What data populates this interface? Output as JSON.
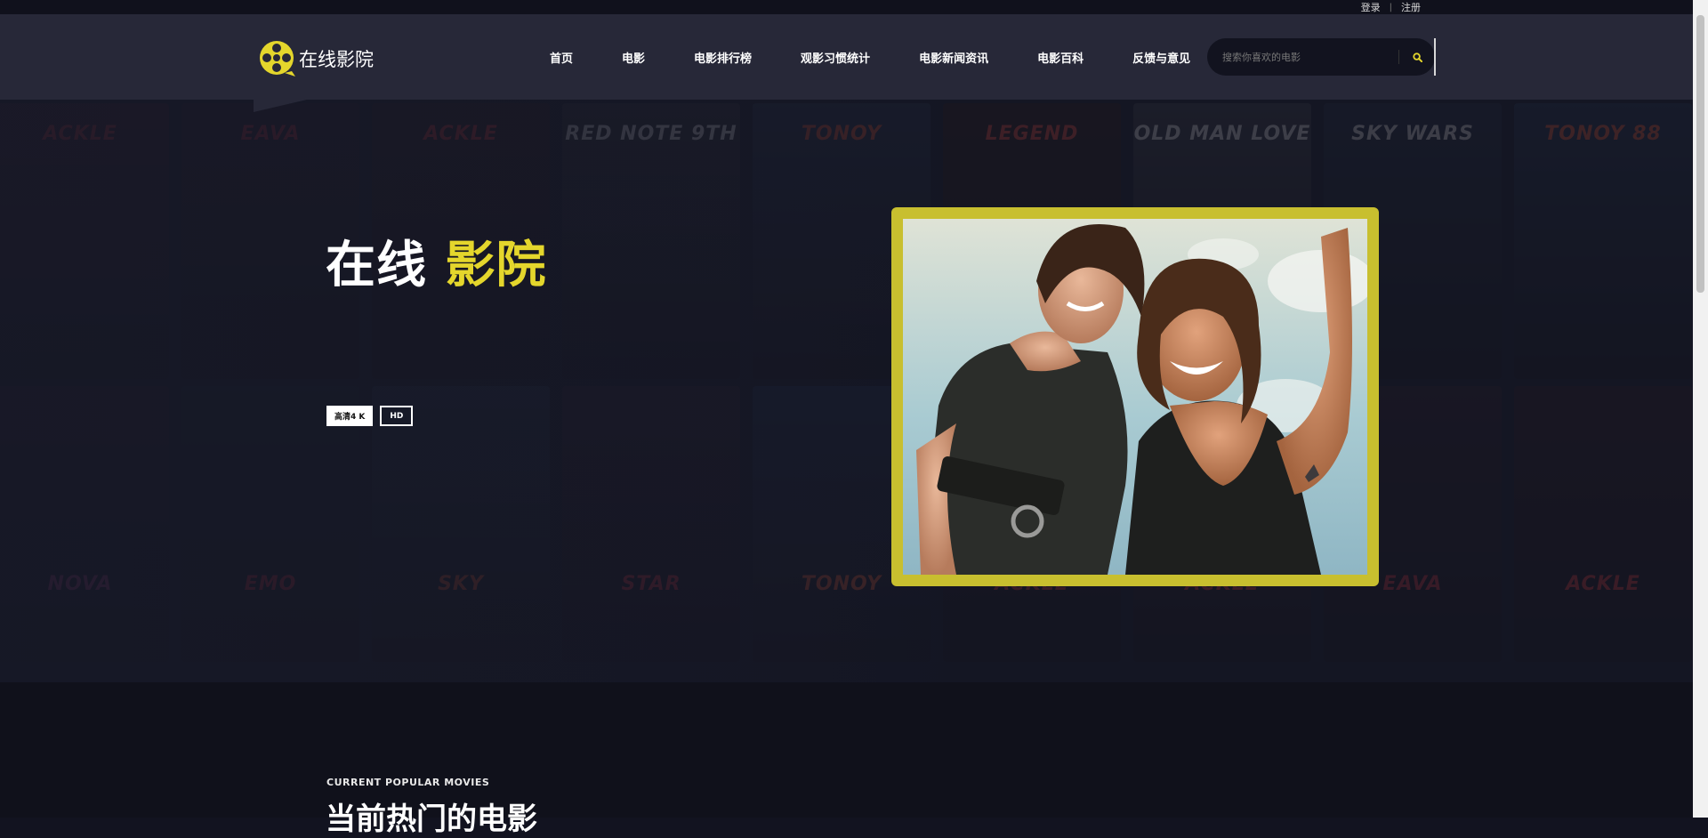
{
  "topbar": {
    "login": "登录",
    "separator": "|",
    "register": "注册"
  },
  "header": {
    "logo_text": "在线影院",
    "nav": [
      {
        "label": "首页"
      },
      {
        "label": "电影"
      },
      {
        "label": "电影排行榜"
      },
      {
        "label": "观影习惯统计"
      },
      {
        "label": "电影新闻资讯"
      },
      {
        "label": "电影百科"
      },
      {
        "label": "反馈与意见"
      }
    ],
    "search_placeholder": "搜索你喜欢的电影"
  },
  "hero": {
    "title_part1": "在线",
    "title_part2": "影院",
    "badges": [
      "高清4 K",
      "HD"
    ],
    "posters": [
      {
        "title": "ACKLE"
      },
      {
        "title": "EAVA"
      },
      {
        "title": "ACKLE"
      },
      {
        "title": "RED NOTE 9TH"
      },
      {
        "title": "TONOY"
      },
      {
        "title": "LEGEND"
      },
      {
        "title": "OLD MAN LOVE"
      },
      {
        "title": "SKY WARS"
      },
      {
        "title": "TONOY 88"
      },
      {
        "title": "NOVA"
      },
      {
        "title": "EMO"
      },
      {
        "title": "SKY"
      },
      {
        "title": "STAR"
      },
      {
        "title": "TONOY"
      },
      {
        "title": "ACKLE"
      }
    ]
  },
  "popular": {
    "kicker": "CURRENT POPULAR MOVIES",
    "heading": "当前热门的电影"
  },
  "colors": {
    "accent": "#e4d62c",
    "header_bg": "#272838",
    "hero_bg": "#181a29",
    "frame": "#c8bf2f"
  }
}
